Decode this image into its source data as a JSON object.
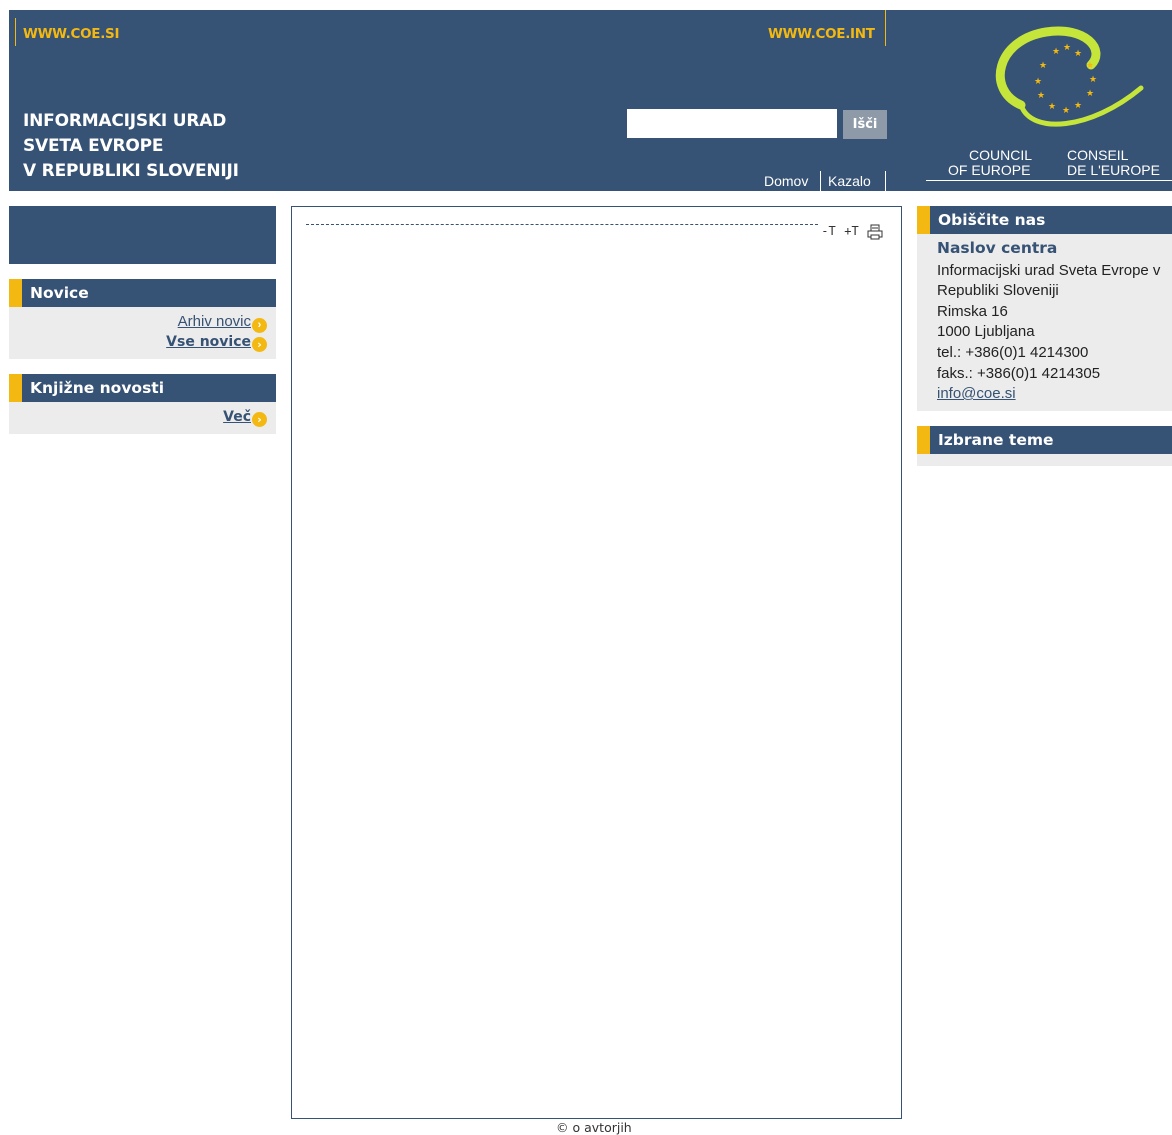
{
  "header": {
    "link_left": "WWW.COE.SI",
    "link_right": "WWW.COE.INT",
    "org_lines": [
      "INFORMACIJSKI URAD",
      "SVETA EVROPE",
      "V REPUBLIKI SLOVENIJI"
    ],
    "search": {
      "value": "",
      "placeholder": "",
      "button_label": "Išči"
    },
    "nav": {
      "home": "Domov",
      "sitemap": "Kazalo"
    },
    "logo": {
      "en_line1": "COUNCIL",
      "en_line2": "OF EUROPE",
      "fr_line1": "CONSEIL",
      "fr_line2": "DE L'EUROPE",
      "arc_color": "#c6e53a",
      "star_color": "#f3b812"
    }
  },
  "left": {
    "novice": {
      "title": "Novice",
      "archive_link": "Arhiv novic",
      "all_link": "Vse novice"
    },
    "books": {
      "title": "Knjižne novosti",
      "more_link": "Več"
    }
  },
  "content": {
    "tools": {
      "decrease": "-T",
      "increase": "+T",
      "print_icon": "printer-icon"
    },
    "footer_link": "o avtorjih"
  },
  "right": {
    "visit": {
      "title": "Obiščite nas",
      "subtitle": "Naslov centra",
      "lines": [
        "Informacijski urad Sveta Evrope v",
        "Republiki Sloveniji",
        "Rimska 16",
        "1000 Ljubljana",
        "tel.: +386(0)1 4214300",
        "faks.: +386(0)1 4214305"
      ],
      "email": "info@coe.si"
    },
    "topics": {
      "title": "Izbrane teme"
    }
  },
  "colors": {
    "navy": "#365274",
    "gold": "#f3b812",
    "panel_gray": "#ececec"
  }
}
